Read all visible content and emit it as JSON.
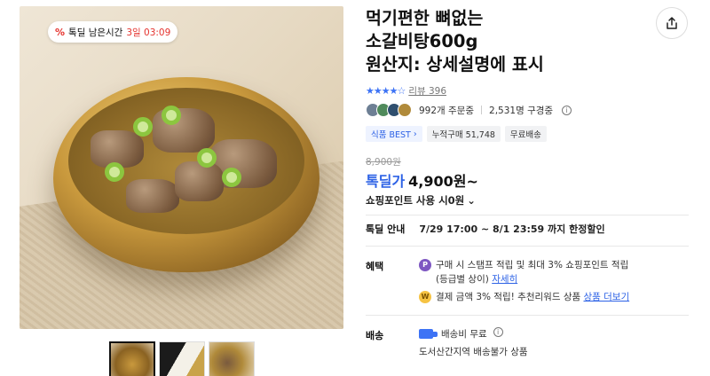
{
  "promo_badge": {
    "label": "톡딜 남은시간",
    "time": "3일 03:09"
  },
  "product": {
    "title": "먹기편한 뼈없는\n소갈비탕600g\n원산지: 상세설명에 표시",
    "review_text": "리뷰 396",
    "orders_text": "992개 주문중",
    "subscribers_text": "2,531명 구경중",
    "tags": [
      "식품 BEST",
      "누적구매 51,748",
      "무료배송"
    ],
    "original_price": "8,900원",
    "deal_label": "톡딜가",
    "deal_price": "4,900원~",
    "points_text": "쇼핑포인트 사용 시0원"
  },
  "notice": {
    "label": "톡딜 안내",
    "text": "7/29 17:00 ~ 8/1 23:59 까지 한정할인"
  },
  "benefits": {
    "label": "혜택",
    "line1": "구매 시 스탬프 적립 및 최대 3% 쇼핑포인트 적립",
    "line1b": "(등급별 상이)",
    "line1_link": "자세히",
    "line2": "결제 금액 3% 적립! 추천리워드 상품",
    "line2_link": "상품 더보기"
  },
  "shipping": {
    "label": "배송",
    "fee": "배송비 무료",
    "note": "도서산간지역 배송불가 상품"
  },
  "colors": {
    "accent_blue": "#2d62e6",
    "promo_red": "#e5322d",
    "star_blue": "#3d73f5"
  },
  "icons": {
    "share": "share-icon",
    "info": "info-icon",
    "chevron": "chevron-right-icon",
    "truck": "truck-icon"
  }
}
